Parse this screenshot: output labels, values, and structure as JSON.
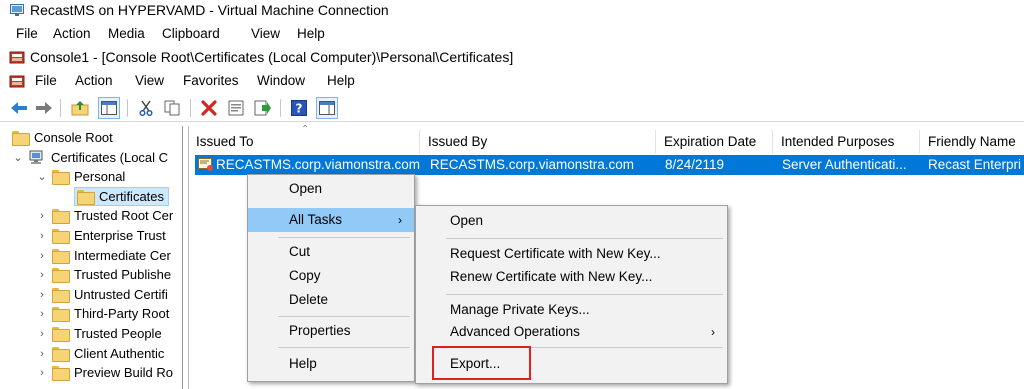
{
  "vm_window": {
    "title": "RecastMS on HYPERVAMD - Virtual Machine Connection",
    "menu": [
      "File",
      "Action",
      "Media",
      "Clipboard",
      "View",
      "Help"
    ]
  },
  "mmc": {
    "title": "Console1 - [Console Root\\Certificates (Local Computer)\\Personal\\Certificates]",
    "menu": [
      "File",
      "Action",
      "View",
      "Favorites",
      "Window",
      "Help"
    ]
  },
  "toolbar": {
    "buttons": [
      "back-arrow-icon",
      "forward-arrow-icon",
      "up-folder-icon",
      "show-hide-tree-icon",
      "cut-icon",
      "copy-icon",
      "delete-icon",
      "properties-icon",
      "export-list-icon",
      "help-icon",
      "action-pane-icon"
    ]
  },
  "tree": {
    "items": [
      "Console Root",
      "Certificates (Local C",
      "Personal",
      "Certificates",
      "Trusted Root Cer",
      "Enterprise Trust",
      "Intermediate Cer",
      "Trusted Publishe",
      "Untrusted Certifi",
      "Third-Party Root",
      "Trusted People",
      "Client Authentic",
      "Preview Build Ro"
    ]
  },
  "list": {
    "columns": [
      "Issued To",
      "Issued By",
      "Expiration Date",
      "Intended Purposes",
      "Friendly Name"
    ],
    "rows": [
      {
        "issued_to": "RECASTMS.corp.viamonstra.com",
        "issued_by": "RECASTMS.corp.viamonstra.com",
        "expiration": "8/24/2119",
        "purposes": "Server Authenticati...",
        "friendly": "Recast Enterpri"
      }
    ]
  },
  "context_menu": {
    "items": [
      "Open",
      "All Tasks",
      "Cut",
      "Copy",
      "Delete",
      "Properties",
      "Help"
    ],
    "submenu_arrow": "›"
  },
  "submenu": {
    "items": [
      "Open",
      "Request Certificate with New Key...",
      "Renew Certificate with New Key...",
      "Manage Private Keys...",
      "Advanced Operations",
      "Export..."
    ],
    "submenu_arrow": "›"
  },
  "colors": {
    "selection": "#0078d7",
    "menu_highlight": "#91c9f7",
    "callout": "#e02020"
  }
}
